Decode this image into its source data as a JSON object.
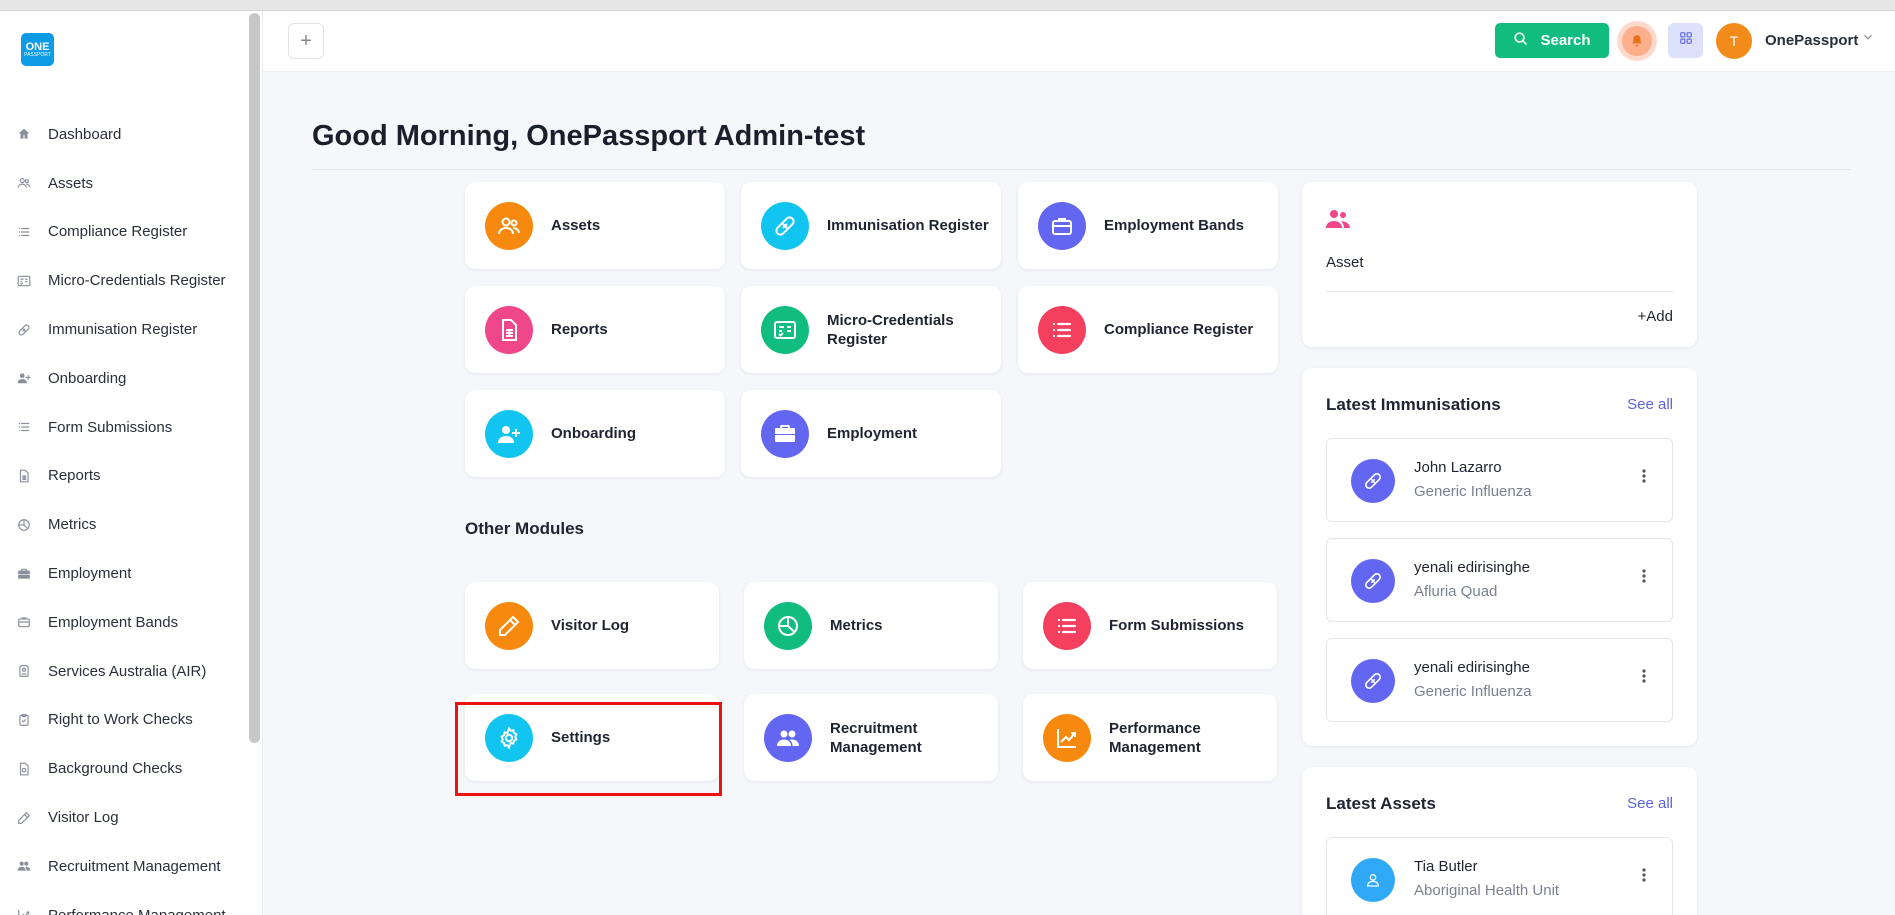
{
  "sidebar": {
    "logo_main": "ONE",
    "logo_sub": "PASSPORT",
    "items": [
      {
        "label": "Dashboard",
        "icon": "home-icon"
      },
      {
        "label": "Assets",
        "icon": "users-icon"
      },
      {
        "label": "Compliance Register",
        "icon": "list-icon"
      },
      {
        "label": "Micro-Credentials Register",
        "icon": "id-card-icon"
      },
      {
        "label": "Immunisation Register",
        "icon": "bandage-icon"
      },
      {
        "label": "Onboarding",
        "icon": "user-plus-icon"
      },
      {
        "label": "Form Submissions",
        "icon": "list-icon"
      },
      {
        "label": "Reports",
        "icon": "document-icon"
      },
      {
        "label": "Metrics",
        "icon": "pie-chart-icon"
      },
      {
        "label": "Employment",
        "icon": "briefcase-icon"
      },
      {
        "label": "Employment Bands",
        "icon": "briefcase-outline-icon"
      },
      {
        "label": "Services Australia (AIR)",
        "icon": "badge-icon"
      },
      {
        "label": "Right to Work Checks",
        "icon": "clipboard-check-icon"
      },
      {
        "label": "Background Checks",
        "icon": "shield-doc-icon"
      },
      {
        "label": "Visitor Log",
        "icon": "pencil-icon"
      },
      {
        "label": "Recruitment Management",
        "icon": "group-icon"
      },
      {
        "label": "Performance Management",
        "icon": "trend-icon"
      }
    ]
  },
  "header": {
    "plus_label": "+",
    "search_label": "Search",
    "avatar_initial": "T",
    "user_name": "OnePassport"
  },
  "greeting": "Good Morning, OnePassport Admin-test",
  "modules": [
    {
      "label": "Assets",
      "color": "#f7890f",
      "icon": "users-icon"
    },
    {
      "label": "Immunisation Register",
      "color": "#12c5f0",
      "icon": "bandage-icon"
    },
    {
      "label": "Employment Bands",
      "color": "#6366f1",
      "icon": "briefcase-outline-icon"
    },
    {
      "label": "Reports",
      "color": "#f0468a",
      "icon": "document-icon"
    },
    {
      "label": "Micro-Credentials Register",
      "color": "#10bd7f",
      "icon": "id-card-icon"
    },
    {
      "label": "Compliance Register",
      "color": "#f43f5e",
      "icon": "list-icon"
    },
    {
      "label": "Onboarding",
      "color": "#12c5f0",
      "icon": "user-plus-icon"
    },
    {
      "label": "Employment",
      "color": "#6366f1",
      "icon": "briefcase-icon"
    }
  ],
  "other_modules_title": "Other Modules",
  "other_modules": [
    {
      "label": "Visitor Log",
      "color": "#f7890f",
      "icon": "pencil-icon"
    },
    {
      "label": "Metrics",
      "color": "#10bd7f",
      "icon": "pie-chart-icon"
    },
    {
      "label": "Form Submissions",
      "color": "#f43f5e",
      "icon": "list-icon"
    },
    {
      "label": "Settings",
      "color": "#12c5f0",
      "icon": "gear-icon"
    },
    {
      "label": "Recruitment Management",
      "color": "#6366f1",
      "icon": "group-icon"
    },
    {
      "label": "Performance Management",
      "color": "#f7890f",
      "icon": "trend-icon"
    }
  ],
  "asset_panel": {
    "title": "Asset",
    "add_label": "Add",
    "add_prefix": "+"
  },
  "latest_immunisations": {
    "title": "Latest Immunisations",
    "see_all": "See all",
    "items": [
      {
        "name": "John Lazarro",
        "sub": "Generic Influenza"
      },
      {
        "name": "yenali edirisinghe",
        "sub": "Afluria Quad"
      },
      {
        "name": "yenali edirisinghe",
        "sub": "Generic Influenza"
      }
    ]
  },
  "latest_assets": {
    "title": "Latest Assets",
    "see_all": "See all",
    "items": [
      {
        "name": "Tia Butler",
        "sub": "Aboriginal Health Unit"
      }
    ]
  }
}
